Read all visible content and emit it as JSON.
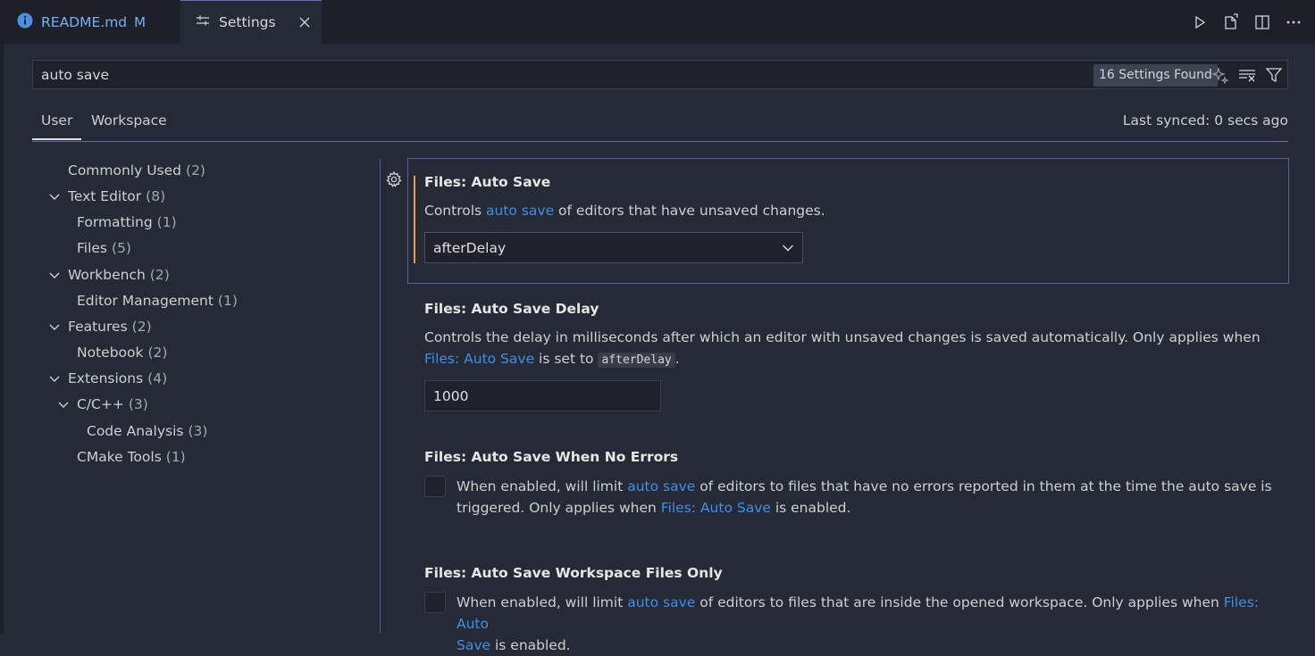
{
  "tabs": {
    "readme": {
      "label": "README.md",
      "badge": "M"
    },
    "settings": {
      "label": "Settings"
    }
  },
  "toolbar": {
    "icons": [
      "run-icon",
      "open-settings-json-icon",
      "split-editor-icon",
      "more-actions-icon"
    ]
  },
  "search": {
    "value": "auto save",
    "results_badge": "16 Settings Found"
  },
  "scope": {
    "user": "User",
    "workspace": "Workspace",
    "sync_status": "Last synced: 0 secs ago"
  },
  "toc": [
    {
      "label": "Commonly Used",
      "count": "(2)"
    },
    {
      "label": "Text Editor",
      "count": "(8)"
    },
    {
      "label": "Formatting",
      "count": "(1)"
    },
    {
      "label": "Files",
      "count": "(5)"
    },
    {
      "label": "Workbench",
      "count": "(2)"
    },
    {
      "label": "Editor Management",
      "count": "(1)"
    },
    {
      "label": "Features",
      "count": "(2)"
    },
    {
      "label": "Notebook",
      "count": "(2)"
    },
    {
      "label": "Extensions",
      "count": "(4)"
    },
    {
      "label": "C/C++",
      "count": "(3)"
    },
    {
      "label": "Code Analysis",
      "count": "(3)"
    },
    {
      "label": "CMake Tools",
      "count": "(1)"
    }
  ],
  "settings": {
    "auto_save": {
      "title": "Files: Auto Save",
      "desc_pre": "Controls ",
      "desc_link": "auto save",
      "desc_post": " of editors that have unsaved changes.",
      "value": "afterDelay"
    },
    "auto_save_delay": {
      "title": "Files: Auto Save Delay",
      "desc_line1": "Controls the delay in milliseconds after which an editor with unsaved changes is saved automatically. Only applies when",
      "desc_link": "Files: Auto Save",
      "desc_mid": " is set to ",
      "desc_code": "afterDelay",
      "desc_end": ".",
      "value": "1000"
    },
    "no_errors": {
      "title": "Files: Auto Save When No Errors",
      "desc_pre": "When enabled, will limit ",
      "desc_link1": "auto save",
      "desc_mid": " of editors to files that have no errors reported in them at the time the auto save is",
      "desc_line2_pre": "triggered. Only applies when ",
      "desc_link2": "Files: Auto Save",
      "desc_end": " is enabled.",
      "checked": false
    },
    "workspace_only": {
      "title": "Files: Auto Save Workspace Files Only",
      "desc_pre": "When enabled, will limit ",
      "desc_link1": "auto save",
      "desc_mid": " of editors to files that are inside the opened workspace. Only applies when ",
      "desc_link2a": "Files: Auto",
      "desc_link2b": "Save",
      "desc_end": " is enabled.",
      "checked": false
    }
  },
  "colors": {
    "accent_link": "#3f8ee8",
    "modified_indicator": "#e2a04a",
    "focus_border": "#5e5f9a"
  }
}
